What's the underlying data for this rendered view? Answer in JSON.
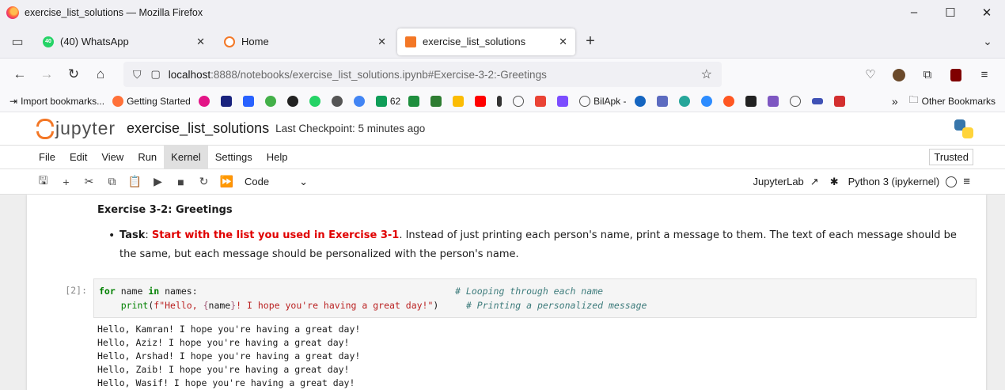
{
  "window": {
    "title": "exercise_list_solutions — Mozilla Firefox",
    "controls": [
      "–",
      "☐",
      "✕"
    ]
  },
  "tabs": [
    {
      "label": "(40) WhatsApp",
      "badge": "40",
      "color": "#25d366"
    },
    {
      "label": "Home",
      "color": "#f37726"
    },
    {
      "label": "exercise_list_solutions",
      "color": "#f37726"
    }
  ],
  "url": {
    "host": "localhost",
    "path": ":8888/notebooks/exercise_list_solutions.ipynb#Exercise-3-2:-Greetings"
  },
  "bookmarks": {
    "import": "Import bookmarks...",
    "getting_started": "Getting Started",
    "classroom_count": "62",
    "bilapk": "BilApk -",
    "other": "Other Bookmarks"
  },
  "jupyter": {
    "logo_text": "jupyter",
    "notebook_name": "exercise_list_solutions",
    "checkpoint": "Last Checkpoint: 5 minutes ago",
    "trusted": "Trusted",
    "menus": [
      "File",
      "Edit",
      "View",
      "Run",
      "Kernel",
      "Settings",
      "Help"
    ],
    "cell_type": "Code",
    "jupyterlab": "JupyterLab",
    "kernel": "Python 3 (ipykernel)"
  },
  "markdown": {
    "heading": "Exercise 3-2: Greetings",
    "task_label": "Task",
    "task_colon": ": ",
    "task_red": "Start with the list you used in Exercise 3-1",
    "task_rest": ". Instead of just printing each person's name, print a message to them. The text of each message should be the same, but each message should be personalized with the person's name."
  },
  "code_cell": {
    "prompt": "[2]:",
    "comment1": "# Looping through each name",
    "comment2": "# Printing a personalized message"
  },
  "output_lines": [
    "Hello, Kamran! I hope you're having a great day!",
    "Hello, Aziz! I hope you're having a great day!",
    "Hello, Arshad! I hope you're having a great day!",
    "Hello, Zaib! I hope you're having a great day!",
    "Hello, Wasif! I hope you're having a great day!"
  ]
}
